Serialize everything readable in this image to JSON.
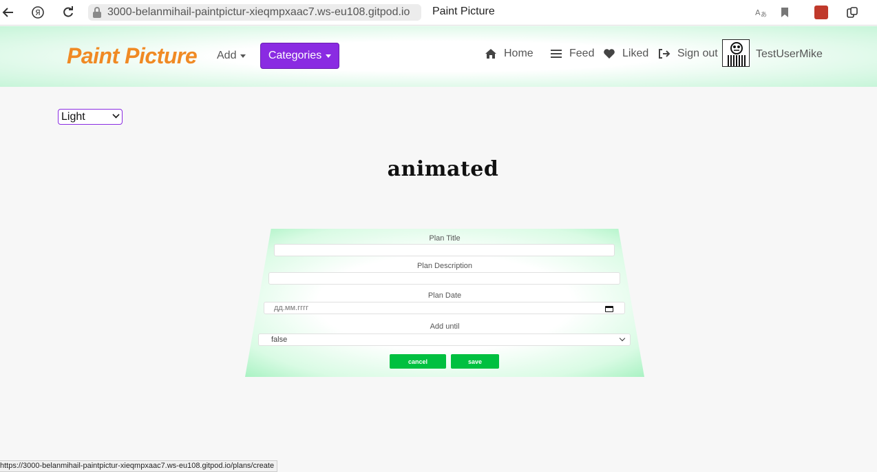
{
  "browser": {
    "address": "3000-belanmihail-paintpictur-xieqmpxaac7.ws-eu108.gitpod.io",
    "tab_title": "Paint Picture",
    "status_url": "https://3000-belanmihail-paintpictur-xieqmpxaac7.ws-eu108.gitpod.io/plans/create"
  },
  "navbar": {
    "brand": "Paint Picture",
    "add_label": "Add",
    "categories_label": "Categories",
    "links": {
      "home": "Home",
      "feed": "Feed",
      "liked": "Liked",
      "sign_out": "Sign out"
    },
    "username": "TestUserMike"
  },
  "theme": {
    "selected": "Light"
  },
  "page": {
    "heading": "animated"
  },
  "form": {
    "title_label": "Plan Title",
    "title_value": "",
    "description_label": "Plan Description",
    "description_value": "",
    "date_label": "Plan Date",
    "date_placeholder": "дд.мм.гггг",
    "add_until_label": "Add until",
    "add_until_value": "false",
    "cancel_label": "cancel",
    "save_label": "save"
  },
  "colors": {
    "brand": "#f08a24",
    "categories_button": "#8a2be2",
    "form_buttons": "#00c040",
    "navbar_glow": "#c7f5d9"
  },
  "icons": [
    "back-arrow-icon",
    "yandex-icon",
    "reload-icon",
    "lock-icon",
    "translate-icon",
    "bookmark-icon",
    "extension-icon",
    "collections-icon",
    "home-icon",
    "feed-icon",
    "heart-icon",
    "sign-out-icon",
    "calendar-icon",
    "chevron-down-icon"
  ]
}
